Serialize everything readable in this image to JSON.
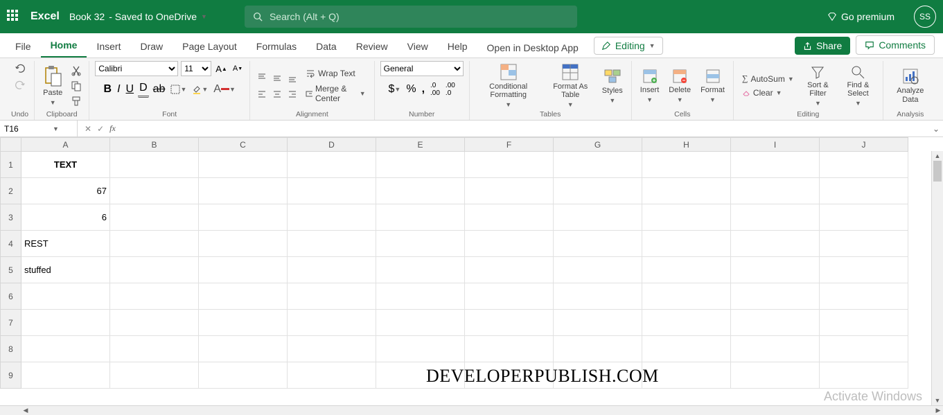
{
  "title": {
    "app": "Excel",
    "doc": "Book 32",
    "saved": " - Saved to OneDrive",
    "premium": "Go premium",
    "avatar": "SS"
  },
  "search": {
    "placeholder": "Search (Alt + Q)"
  },
  "tabs": {
    "file": "File",
    "home": "Home",
    "insert": "Insert",
    "draw": "Draw",
    "pagelayout": "Page Layout",
    "formulas": "Formulas",
    "data": "Data",
    "review": "Review",
    "view": "View",
    "help": "Help",
    "open_desktop": "Open in Desktop App",
    "editing": "Editing",
    "share": "Share",
    "comments": "Comments"
  },
  "ribbon": {
    "undo": "Undo",
    "paste": "Paste",
    "clipboard": "Clipboard",
    "font_name": "Calibri",
    "font_size": "11",
    "font_group": "Font",
    "wrap": "Wrap Text",
    "merge": "Merge & Center",
    "alignment": "Alignment",
    "numfmt": "General",
    "number": "Number",
    "cond": "Conditional Formatting",
    "fat": "Format As Table",
    "styles": "Styles",
    "tables": "Tables",
    "insert": "Insert",
    "delete": "Delete",
    "format": "Format",
    "cells": "Cells",
    "autosum": "AutoSum",
    "clear": "Clear",
    "sort": "Sort & Filter",
    "find": "Find & Select",
    "editing": "Editing",
    "analyze": "Analyze Data",
    "analysis": "Analysis"
  },
  "formula": {
    "namebox": "T16",
    "fx": "fx",
    "value": ""
  },
  "columns": [
    "A",
    "B",
    "C",
    "D",
    "E",
    "F",
    "G",
    "H",
    "I",
    "J"
  ],
  "rows": [
    "1",
    "2",
    "3",
    "4",
    "5",
    "6",
    "7",
    "8",
    "9"
  ],
  "cells": {
    "A1": "TEXT",
    "A2": "67",
    "A3": "6",
    "A4": "REST",
    "A5": "stuffed"
  },
  "watermark": "DEVELOPERPUBLISH.COM",
  "activate": "Activate Windows"
}
